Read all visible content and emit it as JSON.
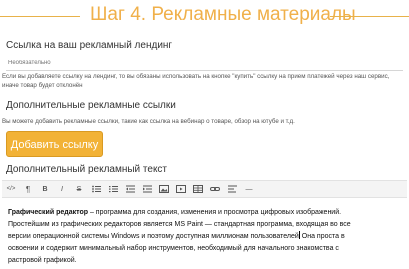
{
  "header": {
    "title": "Шаг 4. Рекламные материалы"
  },
  "landing": {
    "label": "Ссылка на ваш рекламный лендинг",
    "placeholder": "Необязательно",
    "hint_line1": "Если вы добавляете ссылку на лендинг, то вы обязаны использовать на кнопке \"купить\" ссылку на прием платежей через наш сервис,",
    "hint_line2": "иначе товар будет отклонён"
  },
  "extra_links": {
    "label": "Дополнительные рекламные ссылки",
    "hint": "Вы можете добавить рекламные ссылки, такие как ссылка на вебинар о товаре, обзор на ютубе и т.д.",
    "add_button": "Добавить ссылку"
  },
  "extra_text": {
    "label": "Дополнительный рекламный текст"
  },
  "toolbar": {
    "items": [
      {
        "name": "html-code",
        "glyph": "</>"
      },
      {
        "name": "paragraph",
        "glyph": "¶"
      },
      {
        "name": "bold",
        "glyph": "B"
      },
      {
        "name": "italic",
        "glyph": "I"
      },
      {
        "name": "strikethrough",
        "glyph": "S"
      },
      {
        "name": "bullet-list",
        "glyph": ""
      },
      {
        "name": "numbered-list",
        "glyph": ""
      },
      {
        "name": "outdent",
        "glyph": ""
      },
      {
        "name": "indent",
        "glyph": ""
      },
      {
        "name": "image",
        "glyph": ""
      },
      {
        "name": "video",
        "glyph": ""
      },
      {
        "name": "table",
        "glyph": ""
      },
      {
        "name": "link",
        "glyph": ""
      },
      {
        "name": "align",
        "glyph": ""
      },
      {
        "name": "horizontal-rule",
        "glyph": "—"
      }
    ]
  },
  "editor": {
    "bold_term": "Графический редактор",
    "line1_rest": " – программа для создания, изменения и просмотра цифровых изображений.",
    "line2": "Простейшим из графических редакторов является MS Paint — стандартная программа, входящая во все",
    "line3a": "версии операционной системы Windows и поэтому доступная миллионам пользователей",
    "line3b": " Она проста в",
    "line4": "освоении и содержит минимальный набор инструментов, необходимый для начального знакомства с",
    "line5": "растровой графикой."
  }
}
